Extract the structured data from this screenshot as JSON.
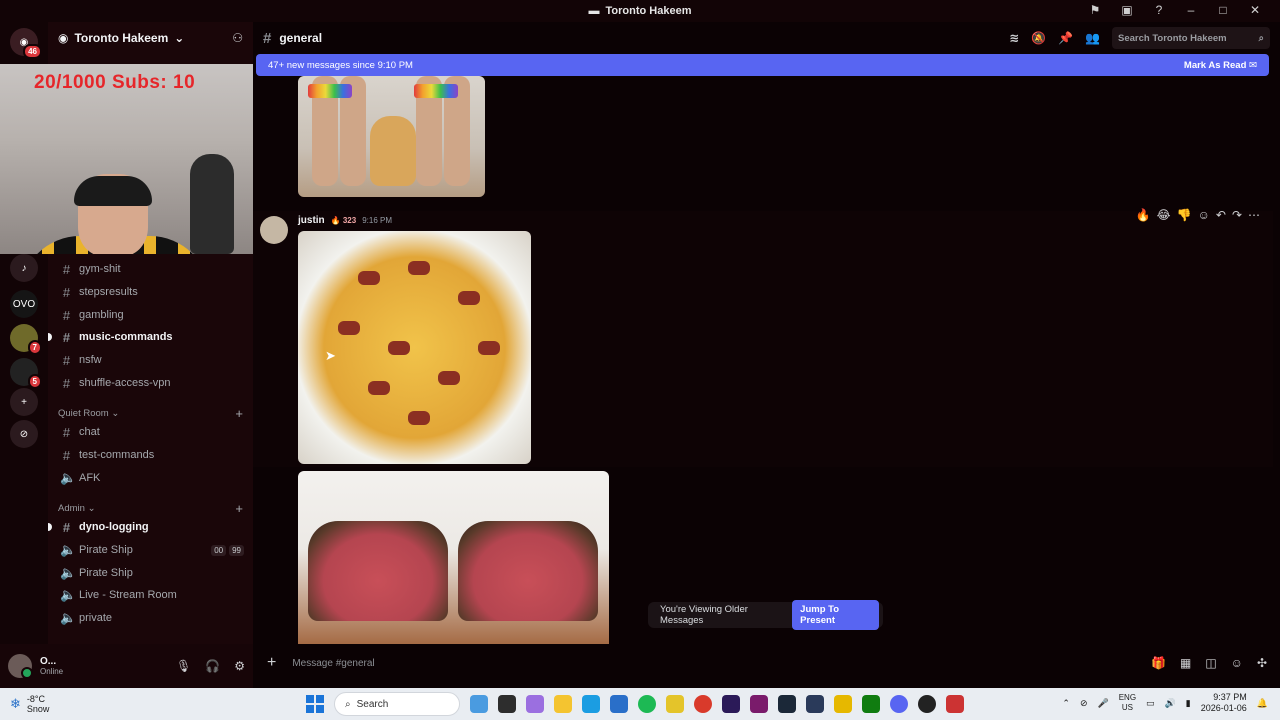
{
  "window": {
    "title": "Toronto Hakeem"
  },
  "titlebar_icons": [
    "flag-icon",
    "inbox-icon",
    "help-icon",
    "minimize-icon",
    "maximize-icon",
    "close-icon"
  ],
  "rail": {
    "home_badge": "46",
    "servers": [
      {
        "name": "server-1",
        "badge": ""
      },
      {
        "name": "ovo-server",
        "badge": "",
        "label": "OVO"
      },
      {
        "name": "server-3",
        "badge": "7"
      },
      {
        "name": "phantom-server",
        "badge": "5"
      }
    ]
  },
  "guild": {
    "name": "Toronto Hakeem"
  },
  "webcam": {
    "overlay_text": "20/1000  Subs: 10"
  },
  "channels": [
    {
      "name": "gym-shit",
      "type": "text",
      "unread": false
    },
    {
      "name": "stepsresults",
      "type": "text",
      "unread": false
    },
    {
      "name": "gambling",
      "type": "text",
      "unread": false
    },
    {
      "name": "music-commands",
      "type": "text",
      "unread": true
    },
    {
      "name": "nsfw",
      "type": "text",
      "unread": false
    },
    {
      "name": "shuffle-access-vpn",
      "type": "text",
      "unread": false
    }
  ],
  "categories": [
    {
      "name": "Quiet Room",
      "channels": [
        {
          "name": "chat",
          "type": "text",
          "unread": false
        },
        {
          "name": "test-commands",
          "type": "text",
          "unread": false
        },
        {
          "name": "AFK",
          "type": "voice",
          "unread": false
        }
      ]
    },
    {
      "name": "Admin",
      "channels": [
        {
          "name": "dyno-logging",
          "type": "text",
          "unread": true
        },
        {
          "name": "Pirate Ship",
          "type": "voice",
          "unread": false,
          "pills": [
            "00",
            "99"
          ]
        },
        {
          "name": "Pirate Ship",
          "type": "voice",
          "unread": false
        },
        {
          "name": "Live - Stream Room",
          "type": "voice",
          "unread": false
        },
        {
          "name": "private",
          "type": "voice",
          "unread": false
        }
      ]
    }
  ],
  "user": {
    "name": "O...",
    "status": "Online"
  },
  "chat": {
    "channel": "general",
    "search_placeholder": "Search Toronto Hakeem",
    "new_messages": "47+ new messages since 9:10 PM",
    "mark_as_read": "Mark As Read",
    "message": {
      "author": "justin",
      "badge": "323",
      "time": "9:16 PM"
    },
    "older_notice": "You're Viewing Older Messages",
    "jump_label": "Jump To Present",
    "composer_placeholder": "Message #general"
  },
  "taskbar": {
    "weather_temp": "-8°C",
    "weather_cond": "Snow",
    "search_label": "Search",
    "lang_1": "ENG",
    "lang_2": "US",
    "time": "9:37 PM",
    "date": "2026-01-06"
  },
  "colors": {
    "accent": "#5865f2",
    "background": "#0b0204",
    "sidebar": "#1a0609"
  }
}
